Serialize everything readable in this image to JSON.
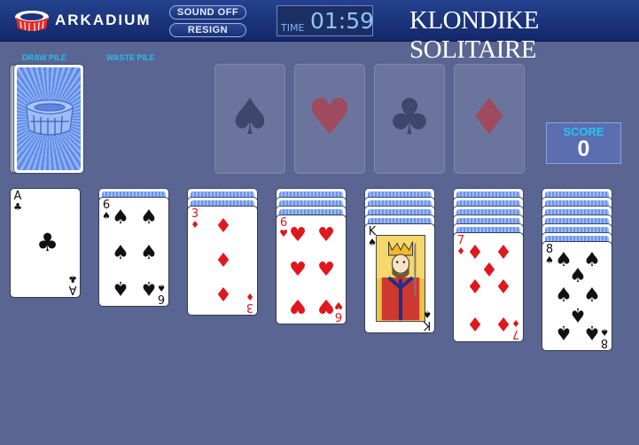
{
  "header": {
    "brand": "ARKADIUM",
    "sound_button": "SOUND OFF",
    "resign_button": "RESIGN",
    "time_label": "TIME",
    "time_value": "01:59",
    "game_title": "KLONDIKE SOLITAIRE"
  },
  "labels": {
    "draw_pile": "DRAW PILE",
    "waste_pile": "WASTE PILE"
  },
  "score": {
    "label": "SCORE",
    "value": "0"
  },
  "foundations": [
    "♠",
    "♥",
    "♣",
    "♦"
  ],
  "tableau": [
    {
      "hidden": 0,
      "card": {
        "rank": "A",
        "suit": "♣",
        "color": "black"
      }
    },
    {
      "hidden": 1,
      "card": {
        "rank": "6",
        "suit": "♠",
        "color": "black"
      }
    },
    {
      "hidden": 2,
      "card": {
        "rank": "3",
        "suit": "♦",
        "color": "red"
      }
    },
    {
      "hidden": 3,
      "card": {
        "rank": "6",
        "suit": "♥",
        "color": "red"
      }
    },
    {
      "hidden": 4,
      "card": {
        "rank": "K",
        "suit": "♠",
        "color": "black"
      }
    },
    {
      "hidden": 5,
      "card": {
        "rank": "7",
        "suit": "♦",
        "color": "red"
      }
    },
    {
      "hidden": 6,
      "card": {
        "rank": "8",
        "suit": "♠",
        "color": "black"
      }
    }
  ],
  "colors": {
    "table": "#5a6591",
    "header": "#1b347b",
    "label_cyan": "#22bff3",
    "red_suit": "#e0171d"
  }
}
